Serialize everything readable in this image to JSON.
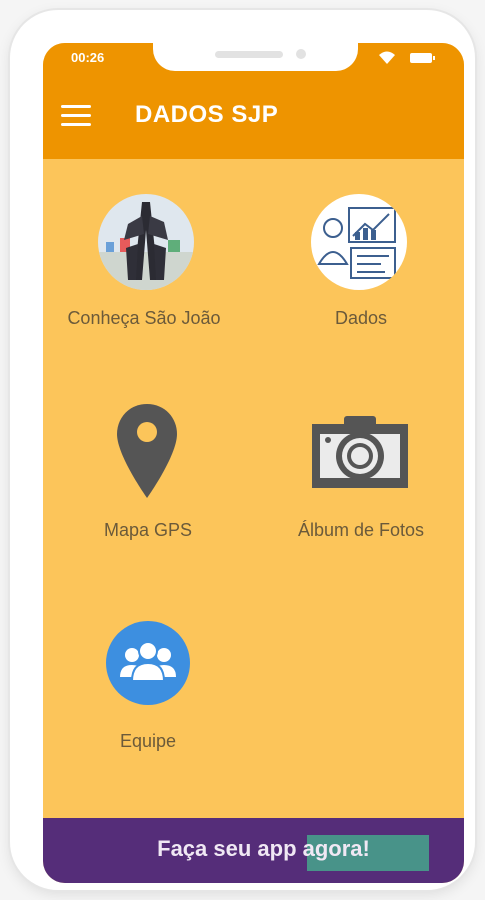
{
  "status_bar": {
    "time": "00:26"
  },
  "app_bar": {
    "title": "DADOS SJP"
  },
  "menu": [
    {
      "label": "Conheça São João",
      "icon": "landmark-photo-icon"
    },
    {
      "label": "Dados",
      "icon": "data-analytics-icon"
    },
    {
      "label": "Mapa GPS",
      "icon": "map-pin-icon"
    },
    {
      "label": "Álbum de Fotos",
      "icon": "camera-icon"
    },
    {
      "label": "Equipe",
      "icon": "team-icon"
    }
  ],
  "cta": {
    "text": "Faça seu app agora!"
  },
  "colors": {
    "app_bar": "#ee9400",
    "background": "#fcc55a",
    "cta_bar": "#552d79",
    "team_circle": "#3d8fe0"
  }
}
